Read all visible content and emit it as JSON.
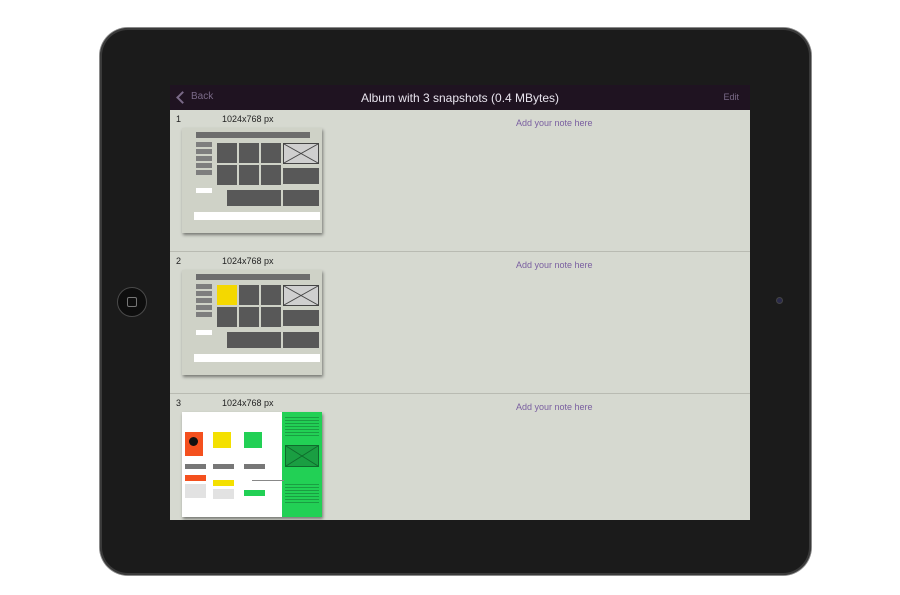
{
  "navbar": {
    "back_label": "Back",
    "title": "Album with 3 snapshots (0.4 MBytes)",
    "edit_label": "Edit"
  },
  "snapshots": [
    {
      "index": "1",
      "dimensions": "1024x768 px",
      "note_placeholder": "Add your note here"
    },
    {
      "index": "2",
      "dimensions": "1024x768 px",
      "note_placeholder": "Add your note here"
    },
    {
      "index": "3",
      "dimensions": "1024x768 px",
      "note_placeholder": "Add your note here"
    }
  ],
  "colors": {
    "navbar_bg": "#1f1321",
    "screen_bg": "#d6d9d0",
    "accent_text": "#7a5fa0",
    "device_bezel": "#1b1b1b"
  },
  "icons": [
    "chevron-left-icon",
    "home-button-icon",
    "camera-icon"
  ]
}
